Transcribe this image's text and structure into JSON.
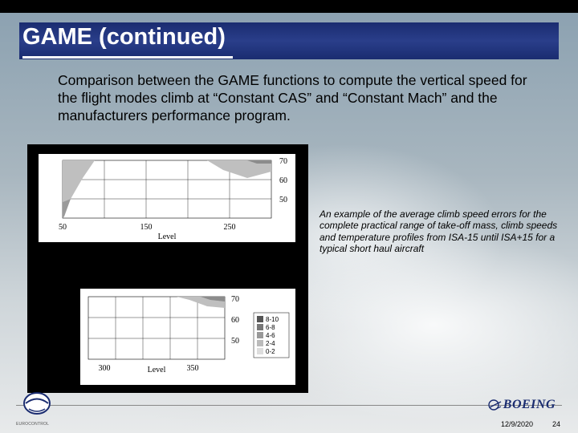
{
  "slide": {
    "title": "GAME (continued)",
    "body": "Comparison between the GAME functions to compute the vertical speed for the flight modes climb at “Constant CAS” and “Constant Mach” and the manufacturers performance program.",
    "caption": "An example of the average climb speed errors for the complete practical range of take-off mass, climb speeds and temperature profiles from ISA-15 until ISA+15 for a typical short haul aircraft",
    "date": "12/9/2020",
    "page": "24",
    "logo_left": "EUROCONTROL",
    "logo_right": "BOEING"
  },
  "chart_data": [
    {
      "type": "heatmap",
      "xlabel": "Level",
      "ylabel": "",
      "x_ticks": [
        50,
        150,
        250
      ],
      "y_ticks": [
        50,
        60,
        70
      ],
      "xlim": [
        50,
        300
      ],
      "ylim": [
        45,
        75
      ]
    },
    {
      "type": "heatmap",
      "xlabel": "Level",
      "ylabel": "",
      "x_ticks": [
        300,
        350
      ],
      "y_ticks": [
        50,
        60,
        70
      ],
      "xlim": [
        290,
        400
      ],
      "ylim": [
        45,
        75
      ],
      "legend": {
        "title": "",
        "bins": [
          "8-10",
          "6-8",
          "4-6",
          "2-4",
          "0-2"
        ]
      }
    }
  ],
  "colors": {
    "band": "#1a2c70"
  }
}
